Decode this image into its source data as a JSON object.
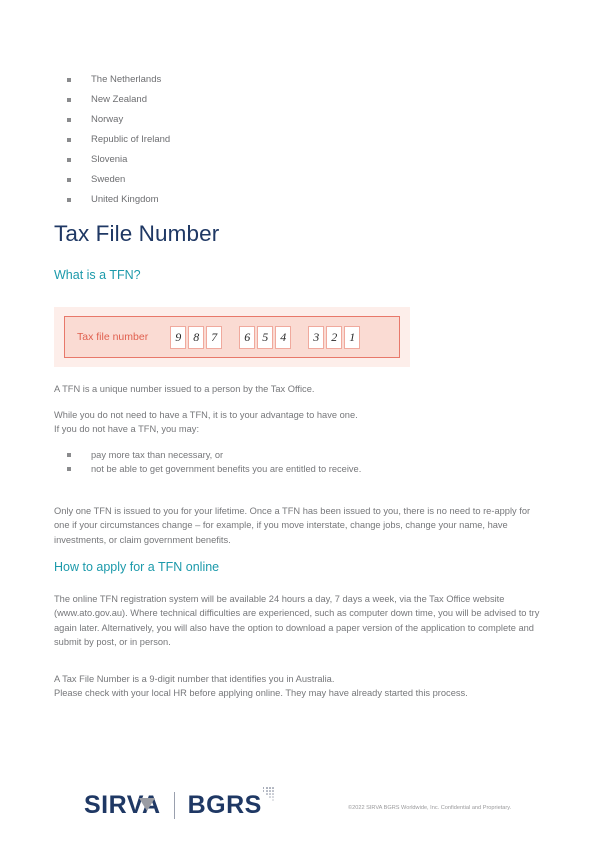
{
  "countries": [
    "The Netherlands",
    "New Zealand",
    "Norway",
    "Republic of Ireland",
    "Slovenia",
    "Sweden",
    "United Kingdom"
  ],
  "title": "Tax File Number",
  "headings": {
    "what_is_tfn": "What is a TFN?",
    "how_to_apply": "How to apply for a TFN online"
  },
  "tfn_figure": {
    "label": "Tax file number",
    "groups": [
      [
        "9",
        "8",
        "7"
      ],
      [
        "6",
        "5",
        "4"
      ],
      [
        "3",
        "2",
        "1"
      ]
    ]
  },
  "paragraphs": {
    "unique": "A TFN is a unique number issued to a person by the Tax Office.",
    "while_line1": "While you do not need to have a TFN, it is to your advantage to have one.",
    "while_line2": "If you do not have a TFN, you may:",
    "only_one": "Only one TFN is issued to you for your lifetime.  Once a TFN has been issued to you, there is no need to re-apply for one if your circumstances change – for example, if you move interstate, change jobs, change your name, have investments, or claim government benefits.",
    "online": "The online TFN registration system will be available 24 hours a day, 7 days a week, via the Tax Office website (www.ato.gov.au). Where technical difficulties are experienced, such as computer down time, you will be advised to try again later.  Alternatively, you will also have the option to download a paper version of the application to complete and submit by post, or in person.",
    "nine_digit_line1": "A Tax File Number is a 9-digit number that identifies you in Australia.",
    "nine_digit_line2": "Please check with your local HR before applying online. They may have already started this process."
  },
  "bullets_tfn": [
    "pay more tax than necessary, or",
    "not be able to get government benefits you are entitled to receive."
  ],
  "footer": {
    "logo_sirva": "SIRVA",
    "logo_bgrs": "BGRS",
    "copyright": "©2022 SIRVA BGRS Worldwide, Inc. Confidential and Proprietary."
  },
  "colors": {
    "title_navy": "#1f3864",
    "heading_teal": "#1c9aab",
    "body_gray": "#76777a",
    "tfn_salmon": "#e0604f",
    "tfn_bg": "#fdeeea",
    "tfn_inner_bg": "#fadbd3"
  }
}
